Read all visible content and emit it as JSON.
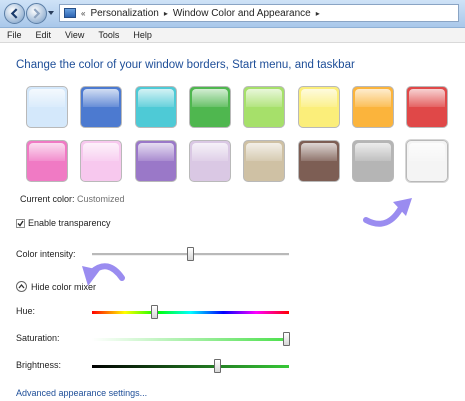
{
  "breadcrumb": {
    "items": [
      "Personalization",
      "Window Color and Appearance"
    ],
    "overflow": "«",
    "separator": "▸"
  },
  "menu": [
    "File",
    "Edit",
    "View",
    "Tools",
    "Help"
  ],
  "heading": "Change the color of your window borders, Start menu, and taskbar",
  "swatches": [
    {
      "color": "#d4e8fb"
    },
    {
      "color": "#4c7ad0"
    },
    {
      "color": "#4ecad6"
    },
    {
      "color": "#4fb74f"
    },
    {
      "color": "#a6e06a"
    },
    {
      "color": "#fbee7a"
    },
    {
      "color": "#fbb43c"
    },
    {
      "color": "#e04848"
    },
    {
      "color": "#f07ac4"
    },
    {
      "color": "#f7c8ee"
    },
    {
      "color": "#9a78c8"
    },
    {
      "color": "#dac8e4"
    },
    {
      "color": "#cfc1a4"
    },
    {
      "color": "#7d5e54"
    },
    {
      "color": "#b5b5b5"
    },
    {
      "color": "#f4f4f4"
    }
  ],
  "selected_swatch": 15,
  "current_color": {
    "label": "Current color:",
    "value": "Customized"
  },
  "transparency": {
    "label": "Enable transparency",
    "checked": true
  },
  "intensity": {
    "label": "Color intensity:",
    "value": 0.5
  },
  "mixer_toggle": {
    "label": "Hide color mixer"
  },
  "hue": {
    "label": "Hue:",
    "value": 0.32
  },
  "saturation": {
    "label": "Saturation:",
    "value": 0.99
  },
  "brightness": {
    "label": "Brightness:",
    "value": 0.64
  },
  "advanced_link": "Advanced appearance settings...",
  "accent_arrow_color": "#9a8cf0"
}
